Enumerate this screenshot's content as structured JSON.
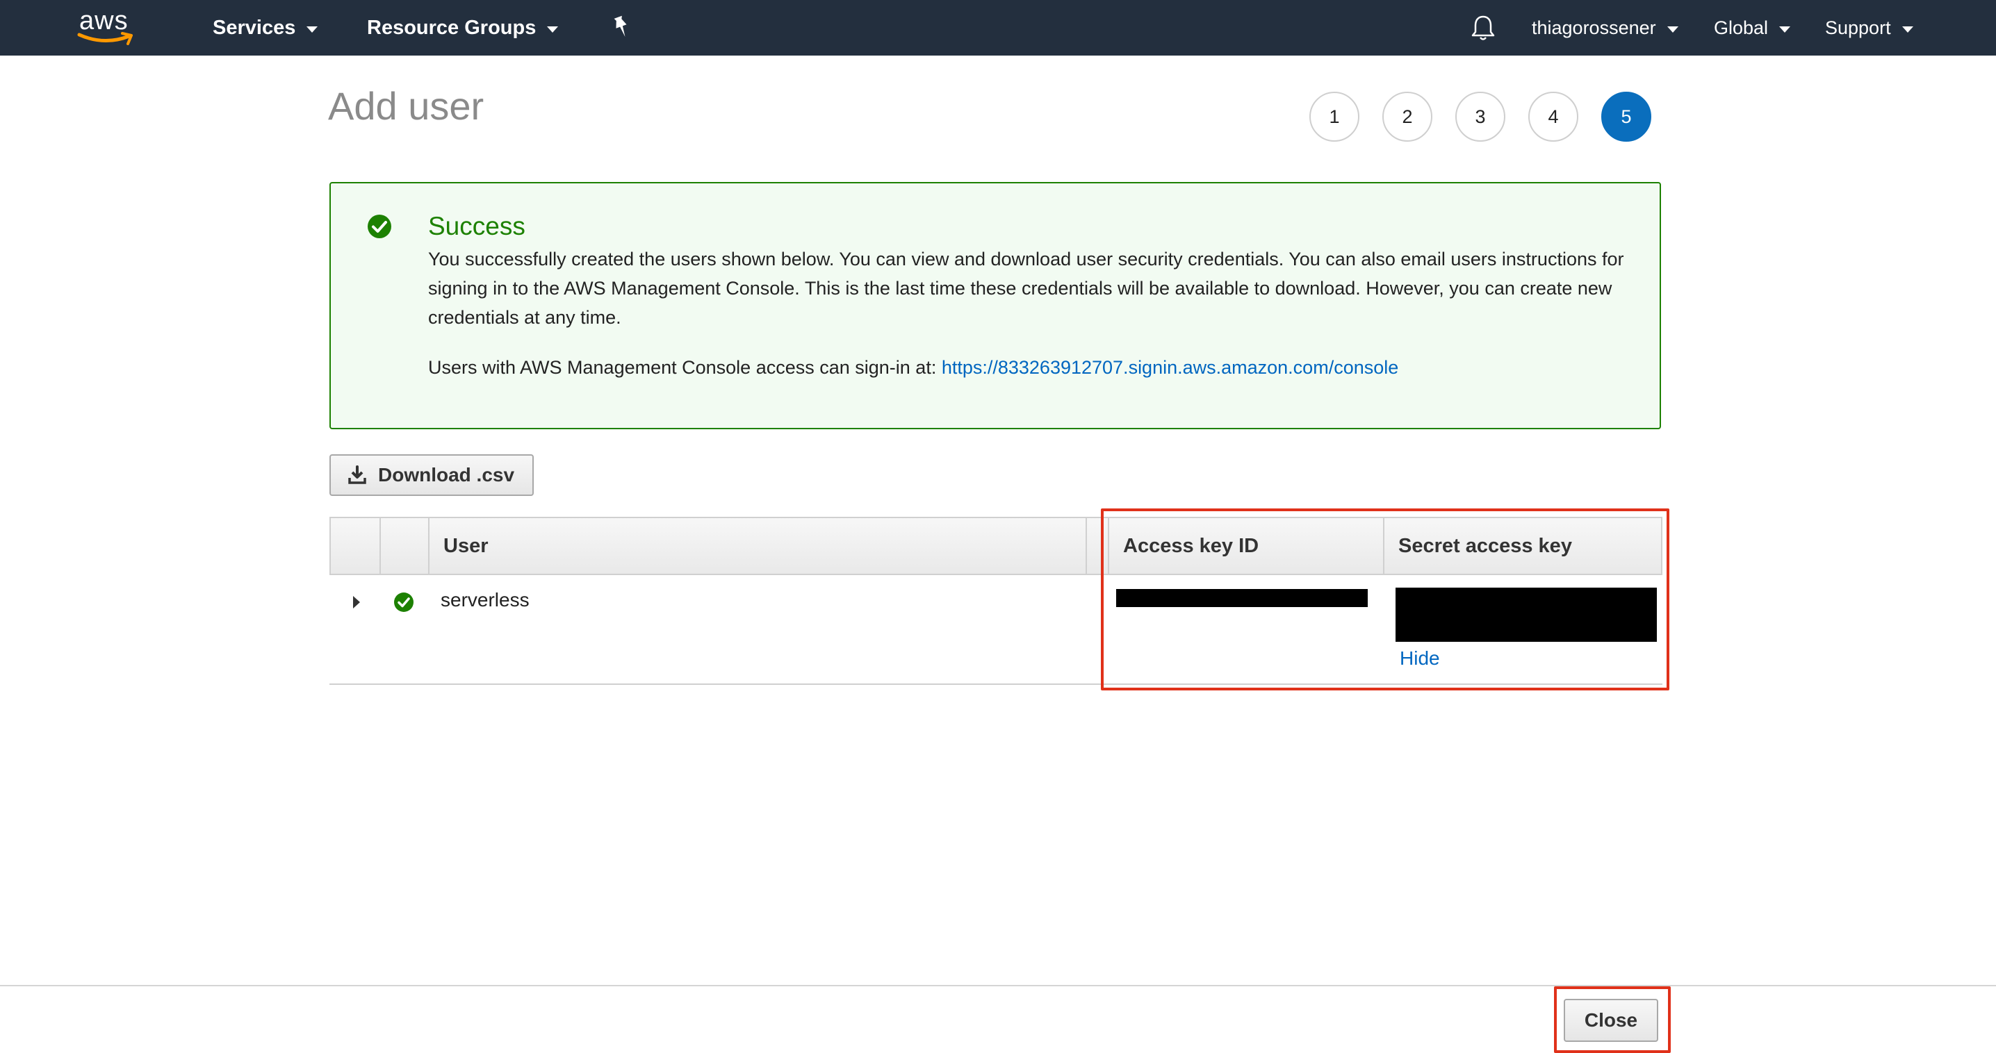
{
  "nav": {
    "logo_text": "aws",
    "services": "Services",
    "resource_groups": "Resource Groups",
    "account": "thiagorossener",
    "region": "Global",
    "support": "Support"
  },
  "page": {
    "title": "Add user",
    "steps": [
      "1",
      "2",
      "3",
      "4",
      "5"
    ],
    "active_step": "5"
  },
  "alert": {
    "title": "Success",
    "body": "You successfully created the users shown below. You can view and download user security credentials. You can also email users instructions for signing in to the AWS Management Console. This is the last time these credentials will be available to download. However, you can create new credentials at any time.",
    "signin_text": "Users with AWS Management Console access can sign-in at: ",
    "signin_url": "https://833263912707.signin.aws.amazon.com/console"
  },
  "download_label": "Download .csv",
  "table": {
    "columns": [
      "User",
      "Access key ID",
      "Secret access key"
    ],
    "rows": [
      {
        "user": "serverless",
        "secret_toggle": "Hide"
      }
    ]
  },
  "footer": {
    "close_label": "Close"
  },
  "colors": {
    "nav_bg": "#232f3e",
    "accent": "#0a6ebd",
    "success": "#1d8102",
    "link": "#0066c0",
    "highlight": "#e0311a"
  }
}
